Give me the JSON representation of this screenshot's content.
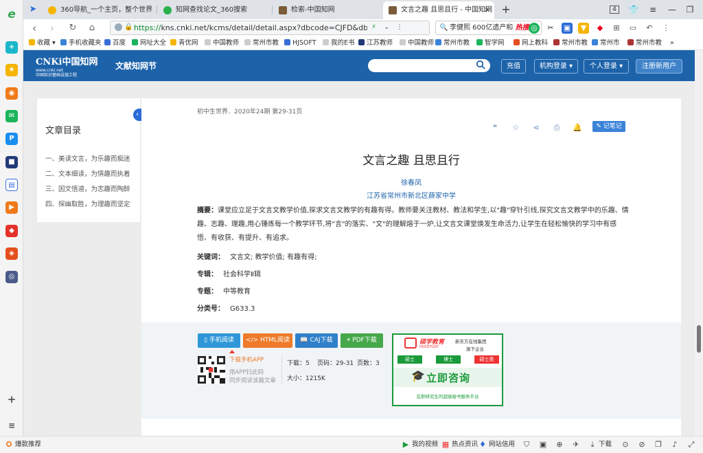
{
  "browser": {
    "tabs": [
      {
        "label": "360导航_一个主页，整个世界",
        "active": false
      },
      {
        "label": "知网查找论文_360搜索",
        "active": false
      },
      {
        "label": "检索-中国知网",
        "active": false
      },
      {
        "label": "文言之趣 且思且行 - 中国知网",
        "active": true
      }
    ],
    "new_tab": "+",
    "tab_count": "4",
    "url_prefix": "https://",
    "url": "kns.cnki.net/kcms/detail/detail.aspx?dbcode=CJFD&dbname=C",
    "search_text": "李健熙 600亿遗产和",
    "search_hot": "热搜",
    "bookmarks": [
      "收藏",
      "手机收藏夹",
      "百度",
      "网址大全",
      "青优网",
      "中国教师",
      "常州市教",
      "HJSOFT",
      "我的E书",
      "江苏教师",
      "中国教师",
      "常州市教",
      "智学网",
      "网上教科",
      "常州市教",
      "常州市",
      "常州市教"
    ],
    "bookmarks_more": "»"
  },
  "site": {
    "logo_text": "CNKi",
    "logo_cn": "中国知网",
    "logo_url": "www.cnki.net",
    "logo_sub": "中国知识基础设施工程",
    "section": "文献知网节",
    "recharge": "充值",
    "org_login": "机构登录",
    "personal_login": "个人登录",
    "register": "注册新用户"
  },
  "toc": {
    "title": "文章目录",
    "items": [
      "一、美读文言，为乐趣而痴迷",
      "二、文本细读，为情趣而执着",
      "三、因文悟道，为志趣而陶醉",
      "四、探幽取胜，为理趣而坚定"
    ]
  },
  "article": {
    "source": "初中生世界．2020年24期   第29-31页",
    "note_button": "记笔记",
    "title": "文言之趣 且思且行",
    "author": "徐春凤",
    "institution": "江苏省常州市新北区薛家中学",
    "abstract_label": "摘要：",
    "abstract": "课堂应立足于文言文教学价值,探求文言文教学的有趣有得。教师要关注教材、教法和学生,以\"趣\"穿针引线,探究文言文教学中的乐趣、情趣、志趣、理趣,用心锤炼每一个教学环节,将\"言\"的落实、\"文\"的理解熔于一炉,让文言文课堂焕发生命活力,让学生在轻松愉快的学习中有感悟、有收获、有提升、有追求。",
    "keywords_label": "关键词：",
    "keywords": "文言文;  教学价值;  有趣有得;",
    "series_label": "专辑：",
    "series": "社会科学Ⅱ辑",
    "topic_label": "专题：",
    "topic": "中等教育",
    "class_label": "分类号：",
    "class_no": "G633.3"
  },
  "download": {
    "mobile": "手机阅读",
    "html": "HTML阅读",
    "caj": "CAJ下载",
    "pdf": "PDF下载",
    "app_link": "下载手机APP",
    "app_hint1": "用APP扫此码",
    "app_hint2": "同步阅读该篇文章",
    "downloads": "下载：5",
    "pages_range": "页码：29-31",
    "page_count": "页数：3",
    "size": "大小：1215K"
  },
  "ad": {
    "brand": "硕学教育",
    "brand_en": "HOOSTUDY",
    "partner": "新东方在线集团",
    "partner_sub": "旗下企业",
    "badge1": "硕士",
    "badge2": "博士",
    "badge3": "硕士类",
    "cta": "立即咨询",
    "tagline": "在职研究生的超级秘书服务平台"
  },
  "status": {
    "left": "爆款推荐",
    "video": "我的视频",
    "news": "热点资讯",
    "credit": "网站信用",
    "download": "下载"
  },
  "colors": {
    "cnki_blue": "#1d63aa",
    "link_blue": "#1d63aa",
    "btn_mobile": "#2f97d8",
    "btn_html": "#ee7a2a",
    "btn_caj": "#2f80c9",
    "btn_pdf": "#46a84b",
    "ad_green": "#1a9a3a"
  }
}
